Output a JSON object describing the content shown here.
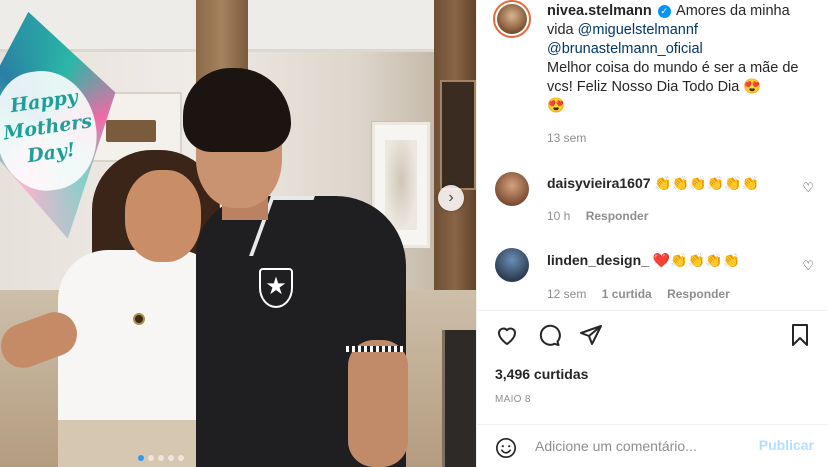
{
  "photo": {
    "balloon_text": "Happy Mothers Day!",
    "carousel_dots": 5,
    "active_dot": 0
  },
  "post": {
    "username": "nivea.stelmann",
    "caption_part1": "Amores da minha vida",
    "mention1": "@miguelstelmannf",
    "mention2": "@brunastelmann_oficial",
    "caption_part2": "Melhor coisa do mundo é ser a mãe de vcs! Feliz Nosso Dia Todo Dia",
    "caption_emoji1": "😍",
    "caption_emoji2": "😍",
    "age": "13 sem"
  },
  "comments": [
    {
      "username": "daisyvieira1607",
      "text": "👏👏👏👏👏👏",
      "age": "10 h",
      "reply": "Responder",
      "likes": ""
    },
    {
      "username": "linden_design_",
      "text": "❤️👏👏👏👏",
      "age": "12 sem",
      "reply": "Responder",
      "likes": "1 curtida"
    }
  ],
  "stats": {
    "likes": "3,496 curtidas",
    "date": "MAIO 8"
  },
  "add_comment": {
    "placeholder": "Adicione um comentário...",
    "publish": "Publicar"
  },
  "colors": {
    "link": "#00376b",
    "verified": "#0095f6",
    "publish_disabled": "#b2dffc",
    "heart": "#ed4956"
  }
}
